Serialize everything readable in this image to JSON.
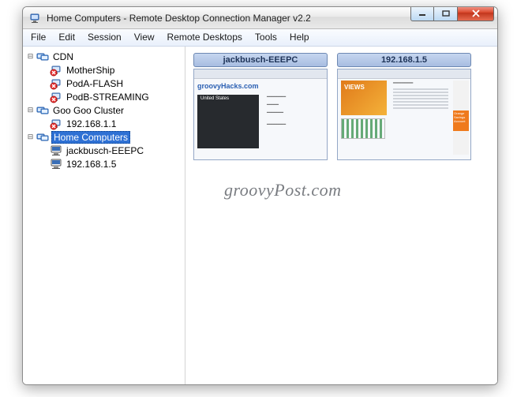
{
  "window": {
    "title": "Home Computers - Remote Desktop Connection Manager v2.2"
  },
  "menu": [
    "File",
    "Edit",
    "Session",
    "View",
    "Remote Desktops",
    "Tools",
    "Help"
  ],
  "tree": {
    "groups": [
      {
        "name": "CDN",
        "expanded": true,
        "selected": false,
        "children": [
          {
            "name": "MotherShip",
            "status": "disconnected"
          },
          {
            "name": "PodA-FLASH",
            "status": "disconnected"
          },
          {
            "name": "PodB-STREAMING",
            "status": "disconnected"
          }
        ]
      },
      {
        "name": "Goo Goo Cluster",
        "expanded": true,
        "selected": false,
        "children": [
          {
            "name": "192.168.1.1",
            "status": "disconnected"
          }
        ]
      },
      {
        "name": "Home Computers",
        "expanded": true,
        "selected": true,
        "children": [
          {
            "name": "jackbusch-EEEPC",
            "status": "connected"
          },
          {
            "name": "192.168.1.5",
            "status": "connected"
          }
        ]
      }
    ]
  },
  "thumbnails": [
    {
      "title": "jackbusch-EEEPC",
      "preview": {
        "site": "groovyHacks.com",
        "panel": "United States"
      }
    },
    {
      "title": "192.168.1.5",
      "preview": {
        "banner": "VIEWS",
        "sidebox": "Orange Savings Account"
      }
    }
  ],
  "watermark": "groovyPost.com"
}
